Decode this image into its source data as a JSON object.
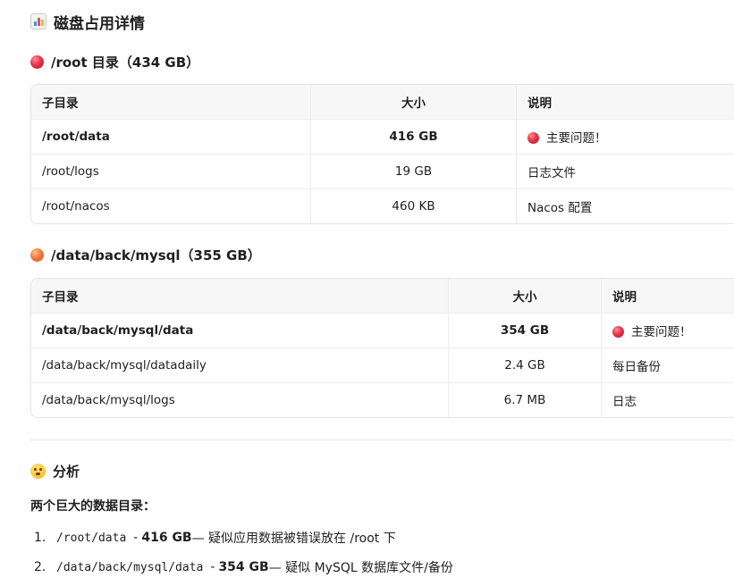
{
  "heading": {
    "title": "磁盘占用详情",
    "icon": "bar-chart-icon"
  },
  "sections": [
    {
      "title": "/root 目录（434 GB）",
      "dot_color": "#e8334a",
      "headers": [
        "子目录",
        "大小",
        "说明"
      ],
      "rows": [
        {
          "dir": "/root/data",
          "size": "416 GB",
          "note": "主要问题！",
          "bold": true,
          "flag": true
        },
        {
          "dir": "/root/logs",
          "size": "19 GB",
          "note": "日志文件",
          "bold": false,
          "flag": false
        },
        {
          "dir": "/root/nacos",
          "size": "460 KB",
          "note": "Nacos 配置",
          "bold": false,
          "flag": false
        }
      ]
    },
    {
      "title": "/data/back/mysql（355 GB）",
      "dot_color": "#f47a3a",
      "headers": [
        "子目录",
        "大小",
        "说明"
      ],
      "rows": [
        {
          "dir": "/data/back/mysql/data",
          "size": "354 GB",
          "note": "主要问题！",
          "bold": true,
          "flag": true
        },
        {
          "dir": "/data/back/mysql/datadaily",
          "size": "2.4 GB",
          "note": "每日备份",
          "bold": false,
          "flag": false
        },
        {
          "dir": "/data/back/mysql/logs",
          "size": "6.7 MB",
          "note": "日志",
          "bold": false,
          "flag": false
        }
      ]
    }
  ],
  "analysis": {
    "title": "分析",
    "icon": "thinking-face-icon",
    "summary": "两个巨大的数据目录：",
    "items": [
      {
        "num": "1.",
        "path": "/root/data",
        "sep": "-",
        "size": "416 GB",
        "desc": " — 疑似应用数据被错误放在 /root 下"
      },
      {
        "num": "2.",
        "path": "/data/back/mysql/data",
        "sep": "-",
        "size": "354 GB",
        "desc": " — 疑似 MySQL 数据库文件/备份"
      }
    ]
  }
}
